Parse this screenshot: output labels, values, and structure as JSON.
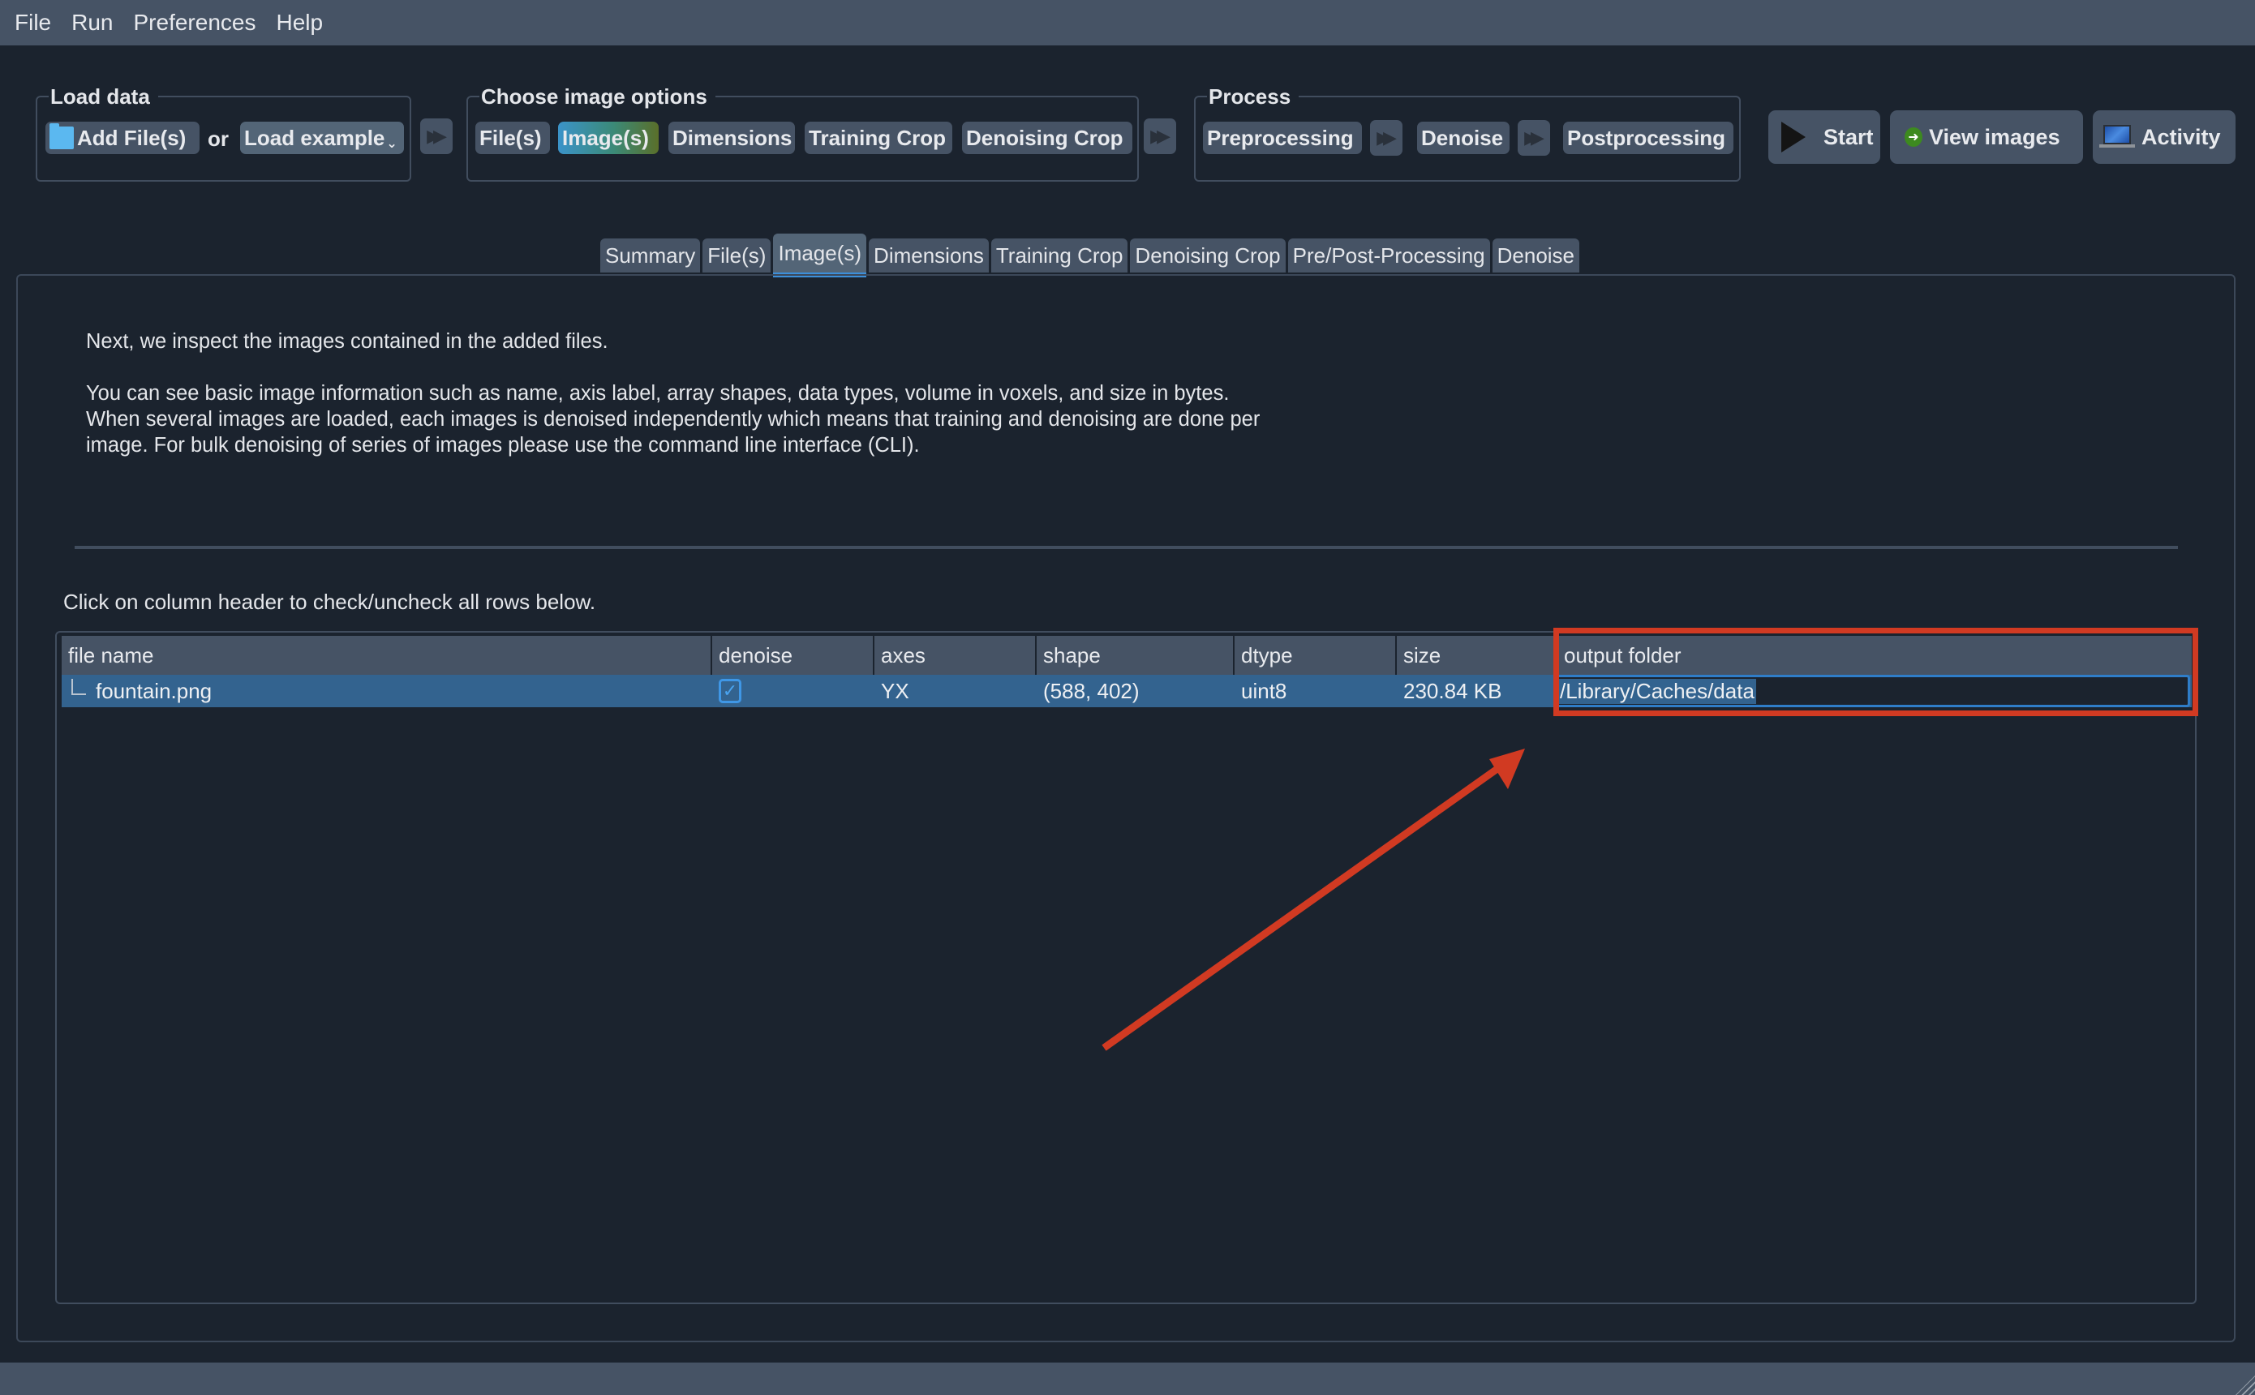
{
  "menubar": {
    "items": [
      "File",
      "Run",
      "Preferences",
      "Help"
    ]
  },
  "load_data": {
    "title": "Load data",
    "add_files_label": "Add File(s)",
    "or_label": "or",
    "load_example_label": "Load example",
    "load_example_icon": "chevron-down-icon",
    "add_files_icon": "folder-icon"
  },
  "image_options": {
    "title": "Choose image options",
    "buttons": [
      "File(s)",
      "Image(s)",
      "Dimensions",
      "Training Crop",
      "Denoising Crop"
    ],
    "active": "Image(s)"
  },
  "process": {
    "title": "Process",
    "buttons": [
      "Preprocessing",
      "Denoise",
      "Postprocessing"
    ]
  },
  "actions": {
    "start_label": "Start",
    "view_images_label": "View images",
    "activity_label": "Activity"
  },
  "tabs": {
    "items": [
      "Summary",
      "File(s)",
      "Image(s)",
      "Dimensions",
      "Training Crop",
      "Denoising Crop",
      "Pre/Post-Processing",
      "Denoise"
    ],
    "active": "Image(s)"
  },
  "description": {
    "para1": "Next, we inspect the images contained in the added files.",
    "para2": "You can see basic image information such as name, axis label, array shapes, data types, volume in voxels, and size in bytes. When several images are loaded, each images is denoised independently which means that training and denoising are done per image. For bulk denoising of series of images please use the command line interface (CLI)."
  },
  "hint": "Click on column header to check/uncheck all rows below.",
  "table": {
    "columns": [
      "file name",
      "denoise",
      "axes",
      "shape",
      "dtype",
      "size",
      "output folder"
    ],
    "rows": [
      {
        "file_name": "fountain.png",
        "denoise": true,
        "axes": "YX",
        "shape": "(588, 402)",
        "dtype": "uint8",
        "size": "230.84 KB",
        "output_folder": "/Library/Caches/data"
      }
    ]
  },
  "annotation": {
    "color": "#d13a22",
    "target": "output folder"
  },
  "colors": {
    "background": "#1b232e",
    "panel": "#465365",
    "selection": "#33638f",
    "accent": "#3d8fd9"
  }
}
